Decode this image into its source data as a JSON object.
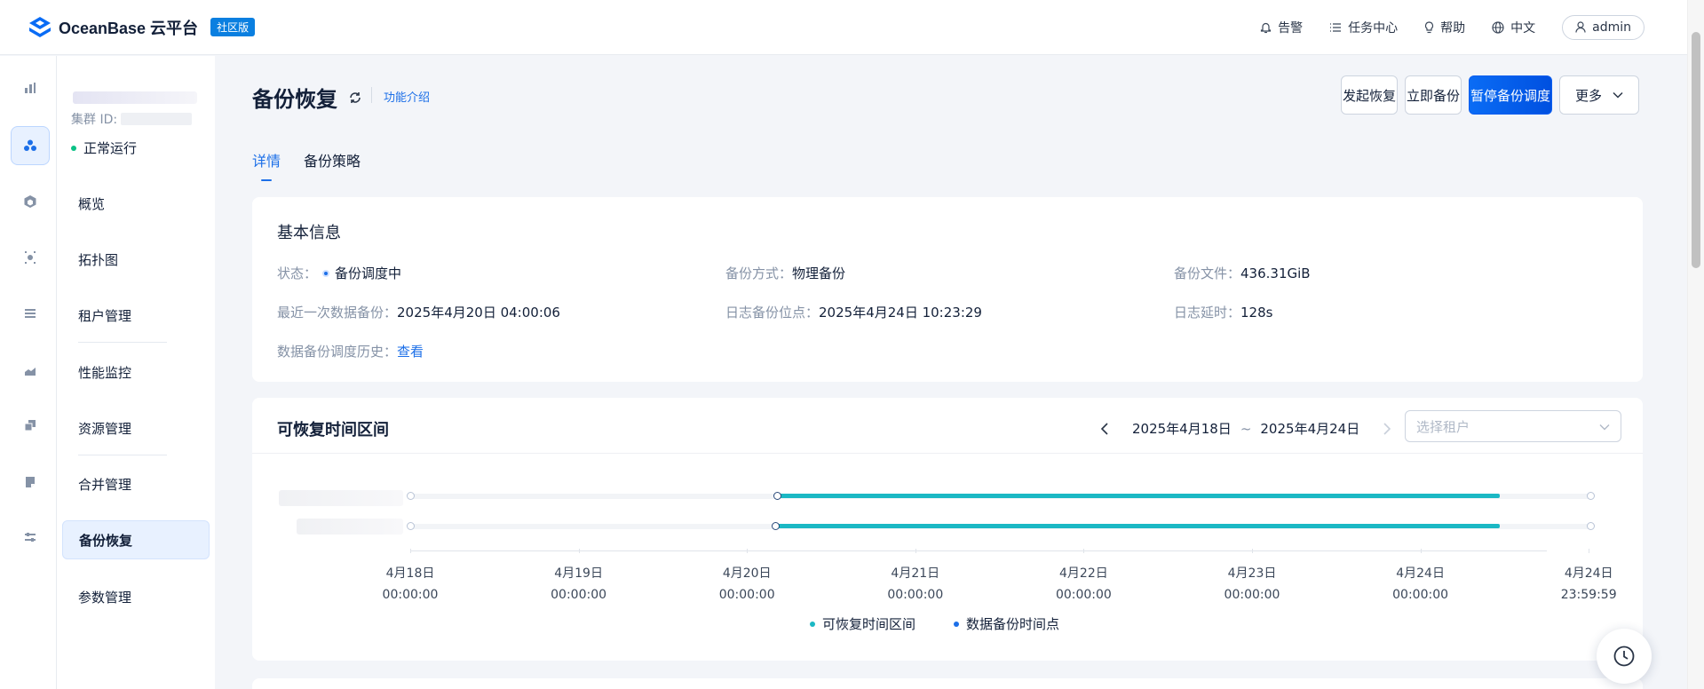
{
  "app": {
    "name": "OceanBase 云平台",
    "edition": "社区版"
  },
  "topbar": {
    "alert": "告警",
    "tasks": "任务中心",
    "help": "帮助",
    "lang": "中文",
    "user": "admin"
  },
  "cluster": {
    "id_label": "集群 ID:",
    "status": "正常运行"
  },
  "nav": [
    {
      "label": "概览"
    },
    {
      "label": "拓扑图"
    },
    {
      "label": "租户管理"
    },
    {
      "label": "性能监控"
    },
    {
      "label": "资源管理"
    },
    {
      "label": "合并管理"
    },
    {
      "label": "备份恢复"
    },
    {
      "label": "参数管理"
    }
  ],
  "page": {
    "title": "备份恢复",
    "intro": "功能介绍",
    "buttons": {
      "restore": "发起恢复",
      "backup_now": "立即备份",
      "pause": "暂停备份调度",
      "more": "更多"
    },
    "tabs": [
      "详情",
      "备份策略"
    ]
  },
  "basic_info": {
    "title": "基本信息",
    "status_label": "状态：",
    "status_value": "备份调度中",
    "method_label": "备份方式：",
    "method_value": "物理备份",
    "file_label": "备份文件：",
    "file_value": "436.31GiB",
    "last_label": "最近一次数据备份：",
    "last_value": "2025年4月20日 04:00:06",
    "log_pos_label": "日志备份位点：",
    "log_pos_value": "2025年4月24日 10:23:29",
    "delay_label": "日志延时：",
    "delay_value": "128s",
    "history_label": "数据备份调度历史：",
    "history_link": "查看"
  },
  "recover": {
    "title": "可恢复时间区间",
    "range_start": "2025年4月18日",
    "range_sep": "~",
    "range_end": "2025年4月24日",
    "tenant_placeholder": "选择租户",
    "ticks": [
      {
        "date": "4月18日",
        "time": "00:00:00"
      },
      {
        "date": "4月19日",
        "time": "00:00:00"
      },
      {
        "date": "4月20日",
        "time": "00:00:00"
      },
      {
        "date": "4月21日",
        "time": "00:00:00"
      },
      {
        "date": "4月22日",
        "time": "00:00:00"
      },
      {
        "date": "4月23日",
        "time": "00:00:00"
      },
      {
        "date": "4月24日",
        "time": "00:00:00"
      },
      {
        "date": "4月24日",
        "time": "23:59:59"
      }
    ],
    "legend": {
      "interval": "可恢复时间区间",
      "point": "数据备份时间点"
    },
    "colors": {
      "interval": "#1bb8c4",
      "point": "#1c6fe8"
    }
  }
}
